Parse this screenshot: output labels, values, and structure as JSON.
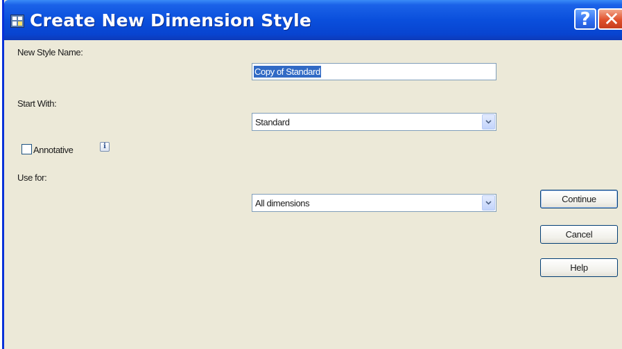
{
  "window": {
    "title": "Create New Dimension Style",
    "help_glyph": "?",
    "close_glyph": "✕"
  },
  "form": {
    "style_name_label": "New Style Name:",
    "style_name_value": "Copy of Standard",
    "start_with_label": "Start With:",
    "start_with_value": "Standard",
    "annotative_label": "Annotative",
    "annotative_checked": false,
    "info_glyph": "i",
    "use_for_label": "Use for:",
    "use_for_value": "All dimensions"
  },
  "buttons": {
    "continue": "Continue",
    "cancel": "Cancel",
    "help": "Help"
  },
  "colors": {
    "titlebar": "#0a4fdc",
    "dialog_bg": "#ece9d8",
    "selection": "#316ac5"
  }
}
